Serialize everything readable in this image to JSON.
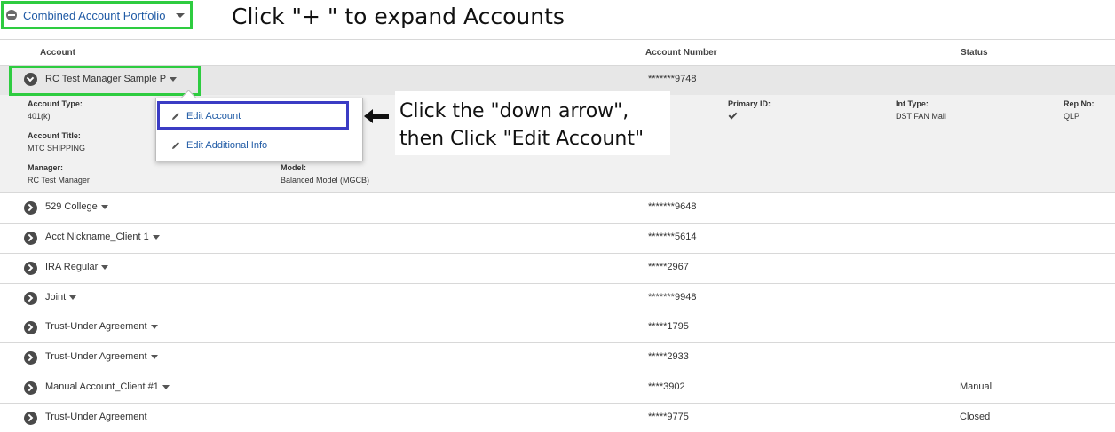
{
  "portfolio": {
    "label": "Combined Account Portfolio"
  },
  "instructions": {
    "top": "Click \"+ \" to expand Accounts",
    "callout_line1": "Click the \"down arrow\",",
    "callout_line2": "then Click \"Edit Account\""
  },
  "table": {
    "headers": {
      "account": "Account",
      "account_number": "Account Number",
      "status": "Status"
    }
  },
  "expanded": {
    "name": "RC Test Manager Sample P",
    "number": "*******9748",
    "details": {
      "account_type_label": "Account Type:",
      "account_type_value": "401(k)",
      "account_title_label": "Account Title:",
      "account_title_value": "MTC SHIPPING",
      "manager_label": "Manager:",
      "manager_value": "RC Test Manager",
      "model_label": "Model:",
      "model_value": "Balanced Model (MGCB)",
      "primary_id_label": "Primary ID:",
      "int_type_label": "Int Type:",
      "int_type_value": "DST FAN Mail",
      "rep_no_label": "Rep No:",
      "rep_no_value": "QLP"
    }
  },
  "menu": {
    "edit_account": "Edit Account",
    "edit_additional_info": "Edit Additional Info"
  },
  "accounts": [
    {
      "name": "529 College",
      "number": "*******9648",
      "status": ""
    },
    {
      "name": "Acct Nickname_Client 1",
      "number": "*******5614",
      "status": ""
    },
    {
      "name": "IRA Regular",
      "number": "*****2967",
      "status": ""
    },
    {
      "name": "Joint",
      "number": "*******9948",
      "status": ""
    },
    {
      "name": "Trust-Under Agreement",
      "number": "*****1795",
      "status": ""
    },
    {
      "name": "Trust-Under Agreement",
      "number": "*****2933",
      "status": ""
    },
    {
      "name": "Manual Account_Client #1",
      "number": "****3902",
      "status": "Manual"
    },
    {
      "name": "Trust-Under Agreement",
      "number": "*****9775",
      "status": "Closed"
    }
  ],
  "colors": {
    "highlight_green": "#2ecc40",
    "highlight_blue": "#3b3cc4",
    "link_blue": "#1f5aa5"
  }
}
